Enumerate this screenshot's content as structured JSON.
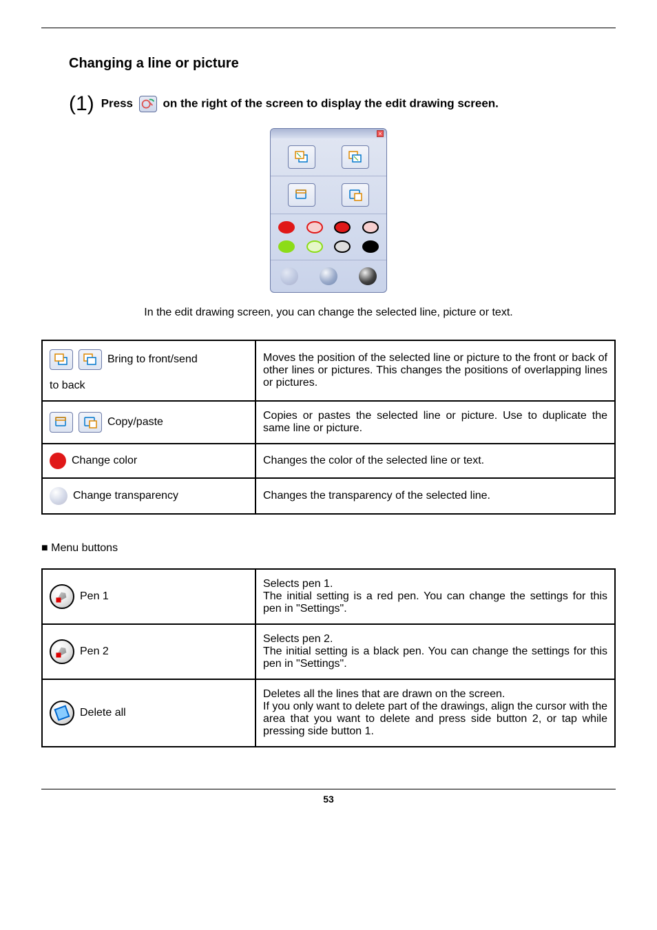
{
  "heading": "Changing a line or picture",
  "step": {
    "num_open": "(",
    "num": "1",
    "num_close": ")",
    "before": "Press",
    "after": "on the right of the screen to display the edit drawing screen."
  },
  "intro": "In the edit drawing screen, you can change the selected line, picture or text.",
  "features": [
    {
      "label_first": "Bring to front/send",
      "label_second": "to back",
      "desc": "Moves the position of the selected line or picture to the front or back of other lines or pictures. This changes the positions of overlapping lines or pictures."
    },
    {
      "label_first": "Copy/paste",
      "desc": "Copies or pastes the selected line or picture. Use to duplicate the same line or picture."
    },
    {
      "label_first": "Change color",
      "desc": "Changes the color of the selected line or text."
    },
    {
      "label_first": "Change transparency",
      "desc": "Changes the transparency of the selected line."
    }
  ],
  "menu_subhead": "■ Menu buttons",
  "menu": [
    {
      "label": "Pen 1",
      "desc": "Selects pen 1.\nThe initial setting is a red pen. You can change the settings for this pen in \"Settings\"."
    },
    {
      "label": "Pen 2",
      "desc": "Selects pen 2.\nThe initial setting is a black pen. You can change the settings for this pen in \"Settings\"."
    },
    {
      "label": "Delete all",
      "desc": "Deletes all the lines that are drawn on the screen.\nIf you only want to delete part of the drawings, align the cursor with the area that you want to delete and press side button 2, or tap while pressing side button 1."
    }
  ],
  "page_number": "53"
}
